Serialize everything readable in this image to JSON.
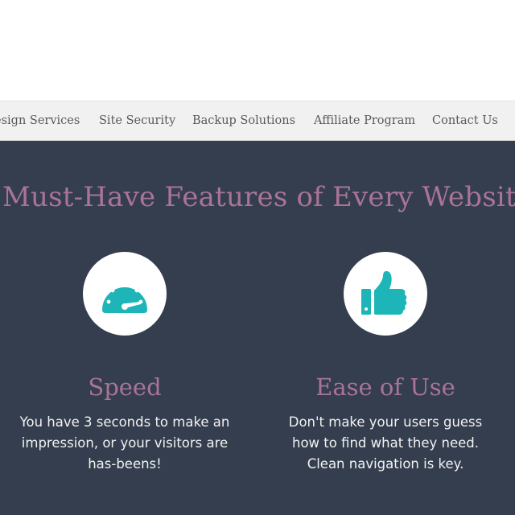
{
  "nav": {
    "items": [
      {
        "label": "esign Services"
      },
      {
        "label": "Site Security"
      },
      {
        "label": "Backup Solutions"
      },
      {
        "label": "Affiliate Program"
      },
      {
        "label": "Contact Us"
      }
    ]
  },
  "section": {
    "headline": "Must-Have Features of Every Websit",
    "features": [
      {
        "icon": "speedometer-icon",
        "title": "Speed",
        "text": "You have 3 seconds to make an impression, or your visitors are has-beens!"
      },
      {
        "icon": "thumbs-up-icon",
        "title": "Ease of Use",
        "text": "Don't make your users guess how to find what they need. Clean navigation is key."
      }
    ]
  },
  "colors": {
    "accent_teal": "#1db5b8",
    "heading_mauve": "#a97497",
    "section_bg": "#343e4e",
    "nav_bg": "#f1f1f1"
  }
}
